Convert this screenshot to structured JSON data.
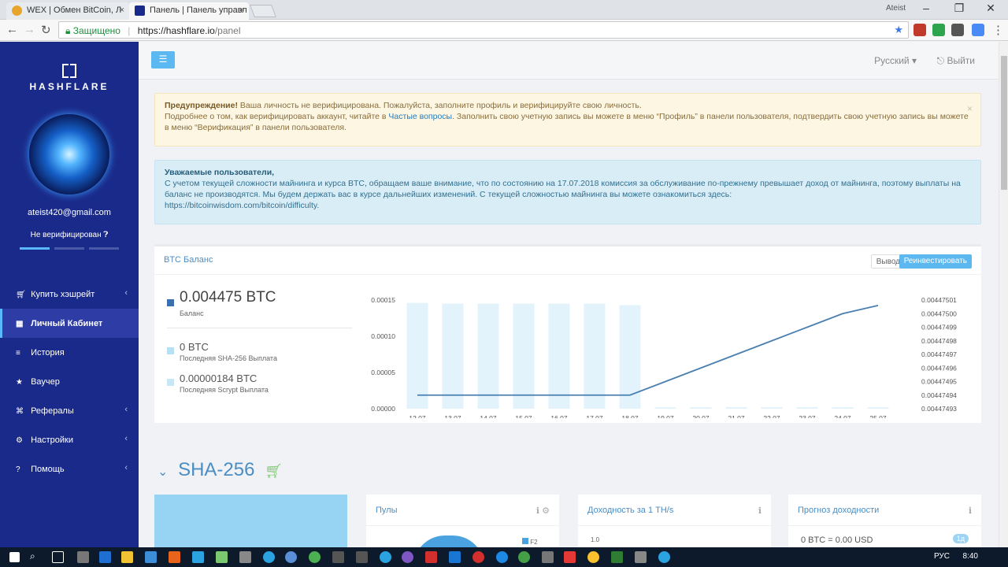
{
  "browser": {
    "tabs": [
      {
        "label": "WEX | Обмен BitCoin, Л",
        "favicon_color": "#e8a52b"
      },
      {
        "label": "Панель | Панель управл",
        "favicon_color": "#1a2a8a"
      }
    ],
    "user": "Ateist",
    "secure_label": "Защищено",
    "url_host": "https://hashflare.io",
    "url_path": "/panel"
  },
  "sidebar": {
    "logo": "HASHFLARE",
    "email": "ateist420@gmail.com",
    "verify_status": "Не верифицирован",
    "menu": [
      {
        "label": "Купить хэшрейт",
        "icon": "cart-icon",
        "glyph": "🛒",
        "has_chevron": true
      },
      {
        "label": "Личный Кабинет",
        "icon": "dashboard-icon",
        "glyph": "▦",
        "active": true
      },
      {
        "label": "История",
        "icon": "list-icon",
        "glyph": "≡"
      },
      {
        "label": "Ваучер",
        "icon": "star-icon",
        "glyph": "★"
      },
      {
        "label": "Рефералы",
        "icon": "sitemap-icon",
        "glyph": "⌘",
        "has_chevron": true
      },
      {
        "label": "Настройки",
        "icon": "gears-icon",
        "glyph": "⚙",
        "has_chevron": true
      },
      {
        "label": "Помощь",
        "icon": "question-icon",
        "glyph": "?",
        "has_chevron": true
      }
    ]
  },
  "topbar": {
    "language": "Русский",
    "logout": "Выйти"
  },
  "alerts": {
    "warning": {
      "title": "Предупреждение!",
      "line1": "Ваша личность не верифицирована. Пожалуйста, заполните профиль и верифицируйте свою личность.",
      "line2_pre": "Подробнее о том, как верифицировать аккаунт, читайте в",
      "line2_link": "Частые вопросы",
      "line2_post": ". Заполнить свою учетную запись вы можете в меню “Профиль” в панели пользователя, подтвердить свою учетную запись вы можете в меню “Верификация” в панели пользователя."
    },
    "info": {
      "title": "Уважаемые пользователи,",
      "body": "С учетом текущей сложности майнинга и курса BTC, обращаем ваше внимание, что по состоянию на 17.07.2018 комиссия за обслуживание по-прежнему превышает доход от майнинга, поэтому выплаты на баланс не производятся. Мы будем держать вас в курсе дальнейших изменений. С текущей сложностью майнинга вы можете ознакомиться здесь:",
      "link": "https://bitcoinwisdom.com/bitcoin/difficulty."
    }
  },
  "balance_panel": {
    "title": "BTC Баланс",
    "btn_withdraw": "Вывод",
    "btn_reinvest": "Реинвестировать",
    "balance": {
      "amount": "0.004475 BTC",
      "label": "Баланс",
      "color": "#3a6fb0"
    },
    "sha_payout": {
      "amount": "0 BTC",
      "label": "Последняя SHA-256 Выплата",
      "color": "#b8e0f5"
    },
    "scrypt_payout": {
      "amount": "0.00000184 BTC",
      "label": "Последняя Scrypt Выплата",
      "color": "#c7e7f7"
    }
  },
  "chart_data": {
    "type": "bar",
    "categories": [
      "12.07",
      "13.07",
      "14.07",
      "15.07",
      "16.07",
      "17.07",
      "18.07",
      "19.07",
      "20.07",
      "21.07",
      "22.07",
      "23.07",
      "24.07",
      "25.07"
    ],
    "series": [
      {
        "type": "bar",
        "axis": "left",
        "values": [
          0.000146,
          0.000145,
          0.000145,
          0.000145,
          0.000145,
          0.000145,
          0.000143,
          0,
          0,
          0,
          0,
          0,
          0,
          0
        ],
        "color": "#e2f3fb"
      },
      {
        "type": "line",
        "axis": "right",
        "values": [
          0.00447494,
          0.00447494,
          0.00447494,
          0.00447494,
          0.00447494,
          0.00447494,
          0.00447494,
          0.00447495,
          0.00447496,
          0.00447497,
          0.00447498,
          0.00447499,
          0.004475,
          0.004475006
        ],
        "color": "#4a7fb0"
      }
    ],
    "y_left": {
      "ticks": [
        "0.00015",
        "0.00010",
        "0.00005",
        "0.00000"
      ],
      "range": [
        0,
        0.00015
      ]
    },
    "y_right": {
      "ticks": [
        "0.00447501",
        "0.00447500",
        "0.00447499",
        "0.00447498",
        "0.00447497",
        "0.00447496",
        "0.00447495",
        "0.00447494",
        "0.00447493"
      ],
      "range": [
        0.00447493,
        0.00447501
      ]
    }
  },
  "sha_section": {
    "title": "SHA-256",
    "cards": [
      {
        "title": "Пулы",
        "legend": "F2"
      },
      {
        "title": "Доходность за 1 TH/s",
        "axis_tick": "1.0"
      },
      {
        "title": "Прогноз доходности",
        "value": "0 BTC = 0.00 USD",
        "badge": "1д"
      }
    ]
  },
  "taskbar": {
    "lang": "РУС",
    "time": "8:40"
  }
}
